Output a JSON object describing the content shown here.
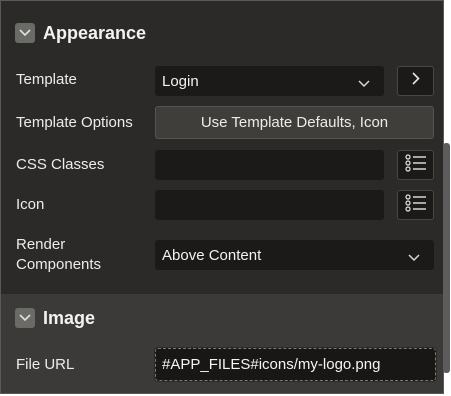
{
  "appearance": {
    "title": "Appearance",
    "template_label": "Template",
    "template_value": "Login",
    "template_options_label": "Template Options",
    "template_options_button": "Use Template Defaults, Icon",
    "css_classes_label": "CSS Classes",
    "css_classes_value": "",
    "icon_label": "Icon",
    "icon_value": "",
    "render_components_label_line1": "Render",
    "render_components_label_line2": "Components",
    "render_components_value": "Above Content"
  },
  "image": {
    "title": "Image",
    "file_url_label": "File URL",
    "file_url_value": "#APP_FILES#icons/my-logo.png"
  },
  "colors": {
    "panel_bg": "#2b2a28",
    "input_bg": "#1b1a19",
    "section_alt_bg": "#3b3a38"
  },
  "icons": {
    "section_toggle": "chevron-down-icon",
    "template_go": "chevron-right-icon",
    "list_picker": "list-icon",
    "select_caret": "chevron-down-icon"
  }
}
